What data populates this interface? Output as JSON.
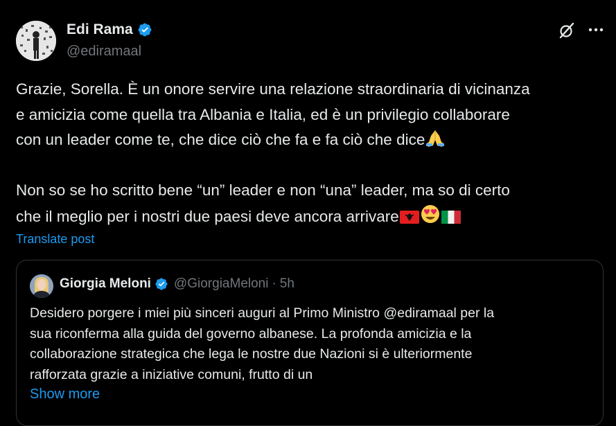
{
  "author": {
    "name": "Edi Rama",
    "handle": "@ediramaal",
    "verified": true,
    "verified_color": "#1d9bf0"
  },
  "header_actions": {
    "grok_icon": "grok-icon",
    "more_icon": "more-dots-icon"
  },
  "post": {
    "lines_p1": [
      "Grazie, Sorella. È un onore servire una relazione straordinaria di vicinanza",
      "e amicizia come quella tra Albania e Italia, ed è un privilegio collaborare",
      "con un leader come te, che dice ciò che fa e fa ciò che dice"
    ],
    "lines_p2": [
      "Non so se ho scritto bene “un” leader e non “una” leader, ma so di certo",
      "che il meglio per i nostri due paesi deve ancora arrivare"
    ],
    "emoji_p1": [
      "folded-hands-emoji"
    ],
    "emoji_p2": [
      "albania-flag-emoji",
      "heart-eyes-emoji",
      "italy-flag-emoji"
    ]
  },
  "translate_label": "Translate post",
  "quote": {
    "name": "Giorgia Meloni",
    "handle": "@GiorgiaMeloni",
    "separator": "·",
    "time": "5h",
    "verified": true,
    "lines": [
      "Desidero porgere i miei più sinceri auguri al Primo Ministro @ediramaal per la",
      "sua riconferma alla guida del governo albanese. La profonda amicizia e la",
      "collaborazione strategica che lega le nostre due Nazioni si è ulteriormente",
      "rafforzata grazie a iniziative comuni, frutto di un"
    ],
    "show_more_label": "Show more"
  },
  "colors": {
    "background": "#000000",
    "text": "#e7e9ea",
    "secondary": "#71767b",
    "accent": "#1d9bf0",
    "border": "#2f3336"
  }
}
